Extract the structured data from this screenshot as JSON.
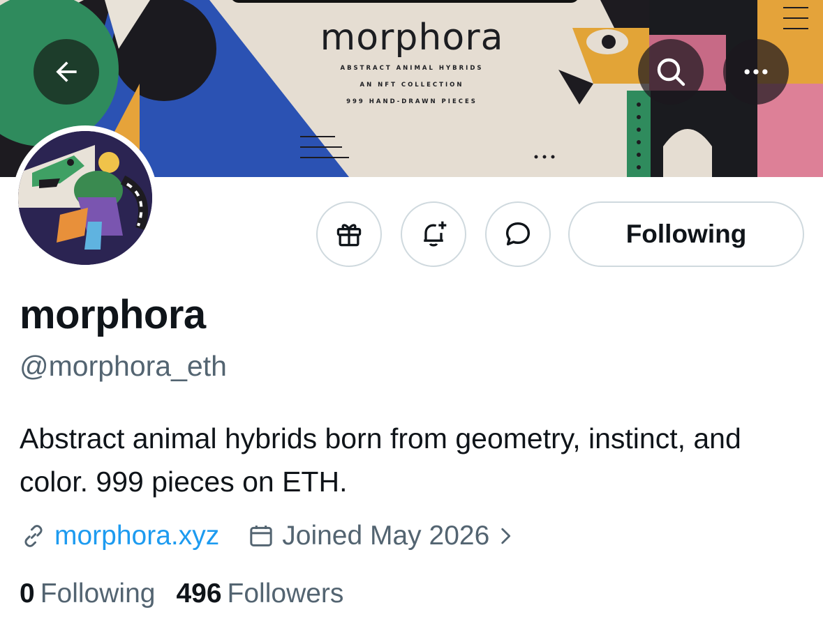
{
  "banner": {
    "brand_name": "morphora",
    "lines": [
      "ABSTRACT ANIMAL HYBRIDS",
      "AN NFT COLLECTION",
      "999 HAND-DRAWN PIECES"
    ]
  },
  "header_buttons": {
    "back": "arrow-left-icon",
    "search": "search-icon",
    "more": "more-horizontal-icon"
  },
  "actions": {
    "gift": "gift-icon",
    "notify": "bell-plus-icon",
    "message": "message-icon",
    "following_label": "Following"
  },
  "profile": {
    "display_name": "morphora",
    "handle": "@morphora_eth",
    "bio": "Abstract animal hybrids born from geometry, instinct, and color. 999 pieces on ETH.",
    "website": "morphora.xyz",
    "joined": "Joined May 2026",
    "following_count": "0",
    "following_label": "Following",
    "followers_count": "496",
    "followers_label": "Followers"
  },
  "colors": {
    "link": "#1d9bf0",
    "secondary_text": "#536471",
    "primary_text": "#0f1419",
    "border": "#cfd9de"
  }
}
